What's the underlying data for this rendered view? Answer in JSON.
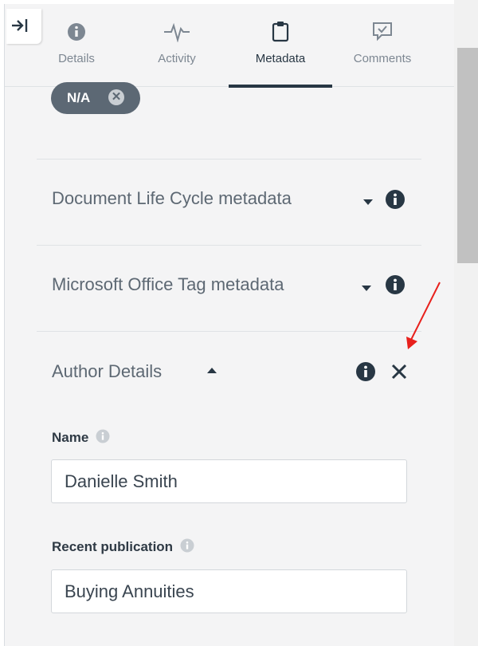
{
  "tabs": [
    {
      "label": "Details",
      "icon": "info-circle-icon"
    },
    {
      "label": "Activity",
      "icon": "activity-pulse-icon"
    },
    {
      "label": "Metadata",
      "icon": "clipboard-icon",
      "active": true
    },
    {
      "label": "Comments",
      "icon": "comment-check-icon"
    }
  ],
  "chip": {
    "label": "N/A",
    "icon": "remove-x-icon"
  },
  "sections": {
    "life_cycle": {
      "title": "Document Life Cycle metadata",
      "expanded": false
    },
    "office_tag": {
      "title": "Microsoft Office Tag metadata",
      "expanded": false
    },
    "author": {
      "title": "Author Details",
      "expanded": true
    }
  },
  "fields": {
    "name": {
      "label": "Name",
      "value": "Danielle Smith"
    },
    "publication": {
      "label": "Recent publication",
      "value": "Buying Annuities"
    }
  },
  "colors": {
    "panel_bg": "#f4f4f5",
    "active_tab": "#283744",
    "chip_bg": "#5c6874",
    "annotation_arrow": "#e8201c"
  }
}
